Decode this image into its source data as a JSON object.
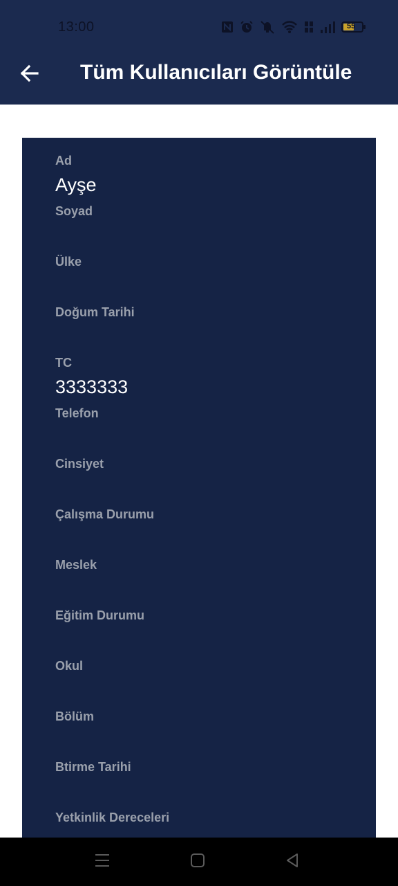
{
  "status_bar": {
    "time": "13:00",
    "battery_level": "55",
    "icons": [
      "nfc-icon",
      "alarm-icon",
      "mute-icon",
      "wifi-icon",
      "volte-icon",
      "signal-icon",
      "battery-icon"
    ]
  },
  "header": {
    "title": "Tüm Kullanıcıları Görüntüle",
    "back_icon": "arrow-left-icon"
  },
  "fields": [
    {
      "label": "Ad",
      "value": "Ayşe"
    },
    {
      "label": "Soyad",
      "value": ""
    },
    {
      "label": "Ülke",
      "value": ""
    },
    {
      "label": "Doğum Tarihi",
      "value": ""
    },
    {
      "label": "TC",
      "value": "3333333"
    },
    {
      "label": "Telefon",
      "value": ""
    },
    {
      "label": "Cinsiyet",
      "value": ""
    },
    {
      "label": "Çalışma Durumu",
      "value": ""
    },
    {
      "label": "Meslek",
      "value": ""
    },
    {
      "label": "Eğitim Durumu",
      "value": ""
    },
    {
      "label": "Okul",
      "value": ""
    },
    {
      "label": "Bölüm",
      "value": ""
    },
    {
      "label": "Btirme Tarihi",
      "value": ""
    },
    {
      "label": "Yetkinlik Dereceleri",
      "value": ""
    }
  ],
  "nav_bar": {
    "icons": [
      "menu-icon",
      "home-icon",
      "back-icon"
    ]
  },
  "colors": {
    "appbar": "#1b2a4f",
    "card": "#152345",
    "label": "#9aa0ac",
    "value": "#ffffff"
  }
}
